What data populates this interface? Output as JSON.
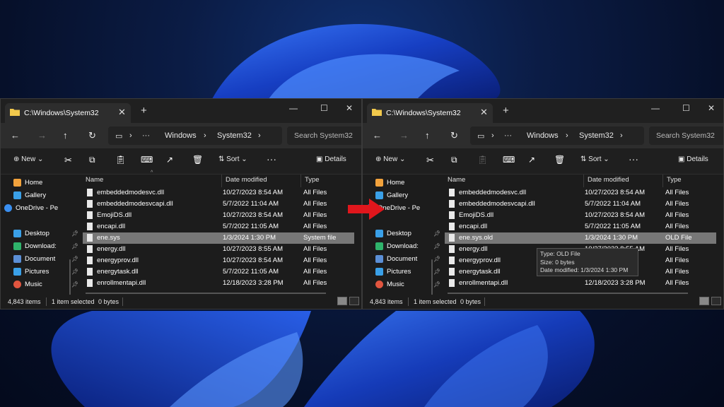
{
  "colors": {
    "window_bg": "#1c1c1c",
    "selection": "#777777",
    "arrow": "#e0161c",
    "folder": "#f2c94c"
  },
  "windows": [
    {
      "tab_title": "C:\\Windows\\System32",
      "breadcrumb": [
        "Windows",
        "System32"
      ],
      "search_placeholder": "Search System32",
      "toolbar": {
        "new_label": "New",
        "sort_label": "Sort",
        "details_label": "Details"
      },
      "nav": [
        {
          "label": "Home",
          "icon": "home-icon"
        },
        {
          "label": "Gallery",
          "icon": "gallery-icon"
        },
        {
          "label": "OneDrive - Pe",
          "icon": "cloud-icon"
        },
        {
          "label": "Desktop",
          "icon": "desktop-icon"
        },
        {
          "label": "Download:",
          "icon": "download-icon"
        },
        {
          "label": "Document",
          "icon": "document-icon"
        },
        {
          "label": "Pictures",
          "icon": "pictures-icon"
        },
        {
          "label": "Music",
          "icon": "music-icon"
        }
      ],
      "columns": {
        "name": "Name",
        "date": "Date modified",
        "type": "Type"
      },
      "files": [
        {
          "name": "embeddedmodesvc.dll",
          "date": "10/27/2023 8:54 AM",
          "type": "All Files"
        },
        {
          "name": "embeddedmodesvcapi.dll",
          "date": "5/7/2022 11:04 AM",
          "type": "All Files"
        },
        {
          "name": "EmojiDS.dll",
          "date": "10/27/2023 8:54 AM",
          "type": "All Files"
        },
        {
          "name": "encapi.dll",
          "date": "5/7/2022 11:05 AM",
          "type": "All Files"
        },
        {
          "name": "ene.sys",
          "date": "1/3/2024 1:30 PM",
          "type": "System file",
          "selected": true
        },
        {
          "name": "energy.dll",
          "date": "10/27/2023 8:55 AM",
          "type": "All Files"
        },
        {
          "name": "energyprov.dll",
          "date": "10/27/2023 8:54 AM",
          "type": "All Files"
        },
        {
          "name": "energytask.dll",
          "date": "5/7/2022 11:05 AM",
          "type": "All Files"
        },
        {
          "name": "enrollmentapi.dll",
          "date": "12/18/2023 3:28 PM",
          "type": "All Files"
        }
      ],
      "status": {
        "items": "4,843 items",
        "selected": "1 item selected",
        "size": "0 bytes"
      }
    },
    {
      "tab_title": "C:\\Windows\\System32",
      "breadcrumb": [
        "Windows",
        "System32"
      ],
      "search_placeholder": "Search System32",
      "toolbar": {
        "new_label": "New",
        "sort_label": "Sort",
        "details_label": "Details"
      },
      "nav": [
        {
          "label": "Home",
          "icon": "home-icon"
        },
        {
          "label": "Gallery",
          "icon": "gallery-icon"
        },
        {
          "label": "OneDrive - Pe",
          "icon": "cloud-icon"
        },
        {
          "label": "Desktop",
          "icon": "desktop-icon"
        },
        {
          "label": "Download:",
          "icon": "download-icon"
        },
        {
          "label": "Document",
          "icon": "document-icon"
        },
        {
          "label": "Pictures",
          "icon": "pictures-icon"
        },
        {
          "label": "Music",
          "icon": "music-icon"
        }
      ],
      "columns": {
        "name": "Name",
        "date": "Date modified",
        "type": "Type"
      },
      "files": [
        {
          "name": "embeddedmodesvc.dll",
          "date": "10/27/2023 8:54 AM",
          "type": "All Files"
        },
        {
          "name": "embeddedmodesvcapi.dll",
          "date": "5/7/2022 11:04 AM",
          "type": "All Files"
        },
        {
          "name": "EmojiDS.dll",
          "date": "10/27/2023 8:54 AM",
          "type": "All Files"
        },
        {
          "name": "encapi.dll",
          "date": "5/7/2022 11:05 AM",
          "type": "All Files"
        },
        {
          "name": "ene.sys.old",
          "date": "1/3/2024 1:30 PM",
          "type": "OLD File",
          "selected": true
        },
        {
          "name": "energy.dll",
          "date": "10/27/2023 8:55 AM",
          "type": "All Files"
        },
        {
          "name": "energyprov.dll",
          "date": "",
          "type": "All Files"
        },
        {
          "name": "energytask.dll",
          "date": "",
          "type": "All Files"
        },
        {
          "name": "enrollmentapi.dll",
          "date": "12/18/2023 3:28 PM",
          "type": "All Files"
        }
      ],
      "tooltip": {
        "type": "Type: OLD File",
        "size": "Size: 0 bytes",
        "date": "Date modified: 1/3/2024 1:30 PM"
      },
      "status": {
        "items": "4,843 items",
        "selected": "1 item selected",
        "size": "0 bytes"
      }
    }
  ]
}
